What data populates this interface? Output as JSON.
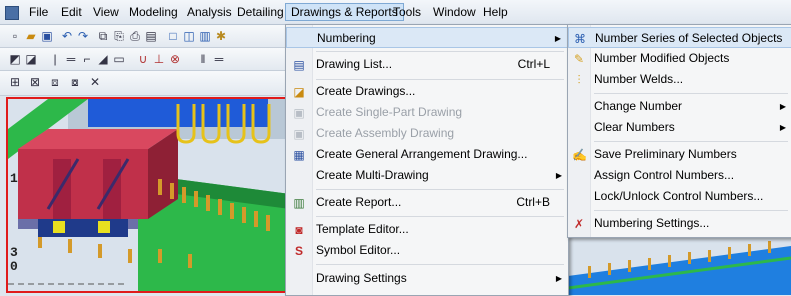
{
  "menubar": {
    "items": [
      "File",
      "Edit",
      "View",
      "Modeling",
      "Analysis",
      "Detailing",
      "Drawings & Reports",
      "Tools",
      "Window",
      "Help"
    ]
  },
  "drawings_menu": {
    "numbering": "Numbering",
    "drawing_list": "Drawing List...",
    "drawing_list_shortcut": "Ctrl+L",
    "create_drawings": "Create Drawings...",
    "create_single_part": "Create Single-Part Drawing",
    "create_assembly": "Create Assembly Drawing",
    "create_ga": "Create General Arrangement Drawing...",
    "create_multi": "Create Multi-Drawing",
    "create_report": "Create Report...",
    "create_report_shortcut": "Ctrl+B",
    "template_editor": "Template Editor...",
    "symbol_editor": "Symbol Editor...",
    "drawing_settings": "Drawing Settings"
  },
  "numbering_submenu": {
    "series_selected": "Number Series of Selected Objects",
    "modified": "Number Modified Objects",
    "welds": "Number Welds...",
    "change_number": "Change Number",
    "clear_numbers": "Clear Numbers",
    "save_preliminary": "Save Preliminary Numbers",
    "assign_control": "Assign Control Numbers...",
    "lock_unlock": "Lock/Unlock Control Numbers...",
    "settings": "Numbering Settings..."
  },
  "viewport": {
    "grid_labels": [
      "1",
      "3",
      "0"
    ]
  },
  "colors": {
    "highlight": "#dbe8f6",
    "steel_red": "#c0304a",
    "beam_blue": "#1f5bd8",
    "floor_green": "#2db84a",
    "bolt": "#d49a2a",
    "selection_border": "#e01b1b"
  }
}
